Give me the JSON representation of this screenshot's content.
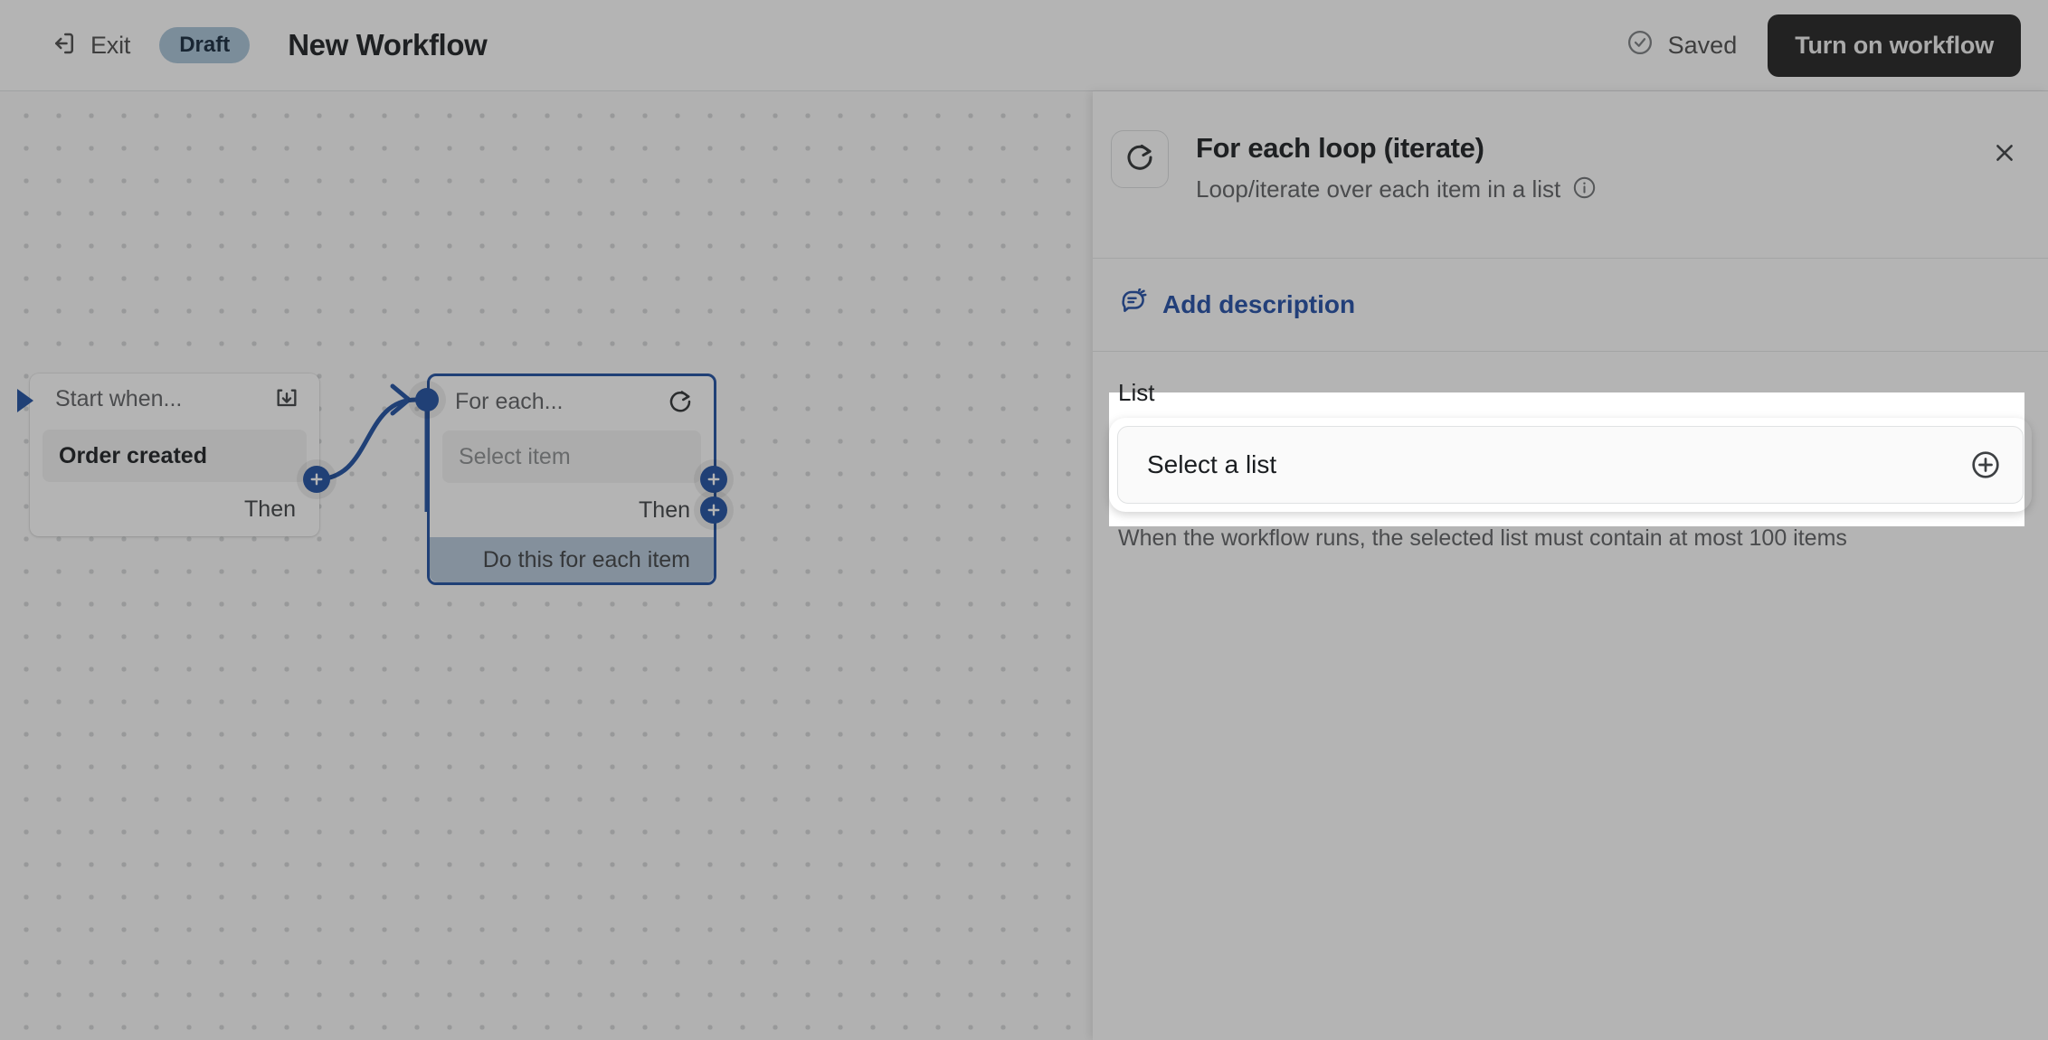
{
  "topbar": {
    "exit_label": "Exit",
    "exit_icon": "exit-icon",
    "status_badge": "Draft",
    "workflow_title": "New Workflow",
    "saved_label": "Saved",
    "saved_icon": "check-circle-icon",
    "turn_on_label": "Turn on workflow"
  },
  "canvas": {
    "trigger_node": {
      "header": "Start when...",
      "header_icon": "import-trigger-icon",
      "value": "Order created",
      "then_label": "Then",
      "add_icon": "plus-icon"
    },
    "loop_node": {
      "header": "For each...",
      "header_icon": "loop-icon",
      "item_placeholder": "Select item",
      "then_label": "Then",
      "loop_branch_label": "Do this for each item",
      "add_icon": "plus-icon",
      "selected": true
    },
    "accent_color": "#1d4ea0",
    "branch_color": "#b6c8da"
  },
  "panel": {
    "icon": "loop-icon",
    "title": "For each loop (iterate)",
    "subtitle": "Loop/iterate over each item in a list",
    "info_icon": "info-icon",
    "close_icon": "close-icon",
    "add_description_label": "Add description",
    "add_description_icon": "description-icon",
    "list_label": "List",
    "list_placeholder": "Select a list",
    "list_add_icon": "plus-circle-icon",
    "list_help": "When the workflow runs, the selected list must contain at most 100 items"
  },
  "colors": {
    "accent_blue": "#1d4ea0",
    "link_blue": "#1f4ca5",
    "draft_badge_bg": "#a8c3d8",
    "draft_badge_text": "#11263a",
    "primary_button_bg": "#1f1f1f",
    "branch_row_bg": "#b6c8da",
    "scrim": "rgba(40,40,40,0.35)"
  }
}
